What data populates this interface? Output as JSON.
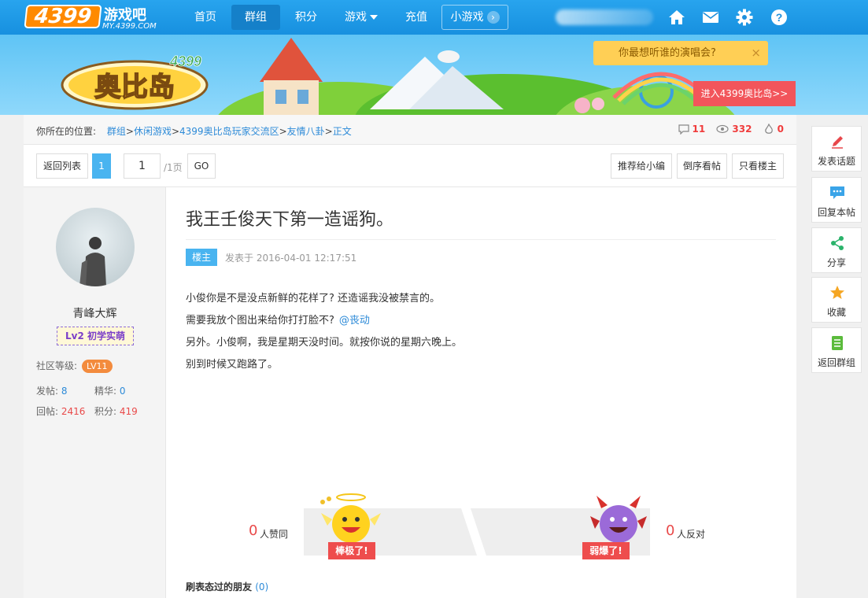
{
  "logo": {
    "number": "4399",
    "cn": "游戏吧",
    "en": "MY.4399.COM"
  },
  "nav": {
    "items": [
      {
        "label": "首页"
      },
      {
        "label": "群组"
      },
      {
        "label": "积分"
      },
      {
        "label": "游戏"
      },
      {
        "label": "充值"
      },
      {
        "label": "小游戏"
      }
    ]
  },
  "banner": {
    "logo_num": "4399",
    "logo_text": "奥比岛",
    "tip": "你最想听谁的演唱会?",
    "tip_close": "×",
    "enter_button": "进入4399奥比岛>>"
  },
  "breadcrumb": {
    "prefix": "你所在的位置:",
    "items": [
      "群组",
      "休闲游戏",
      "4399奥比岛玩家交流区",
      "友情八卦",
      "正文"
    ],
    "sep": ">"
  },
  "stats": {
    "comments": "11",
    "views": "332",
    "likes": "0"
  },
  "toolbar": {
    "back": "返回列表",
    "current_page": "1",
    "page_input": "1",
    "total": "/1页",
    "go": "GO",
    "recommend": "推荐给小编",
    "reverse": "倒序看帖",
    "owner_only": "只看楼主"
  },
  "user": {
    "name": "青峰大辉",
    "badge": "Lv2 初学实萌",
    "level_label": "社区等级:",
    "level": "LV11",
    "posts_label": "发帖:",
    "posts": "8",
    "essence_label": "精华:",
    "essence": "0",
    "replies_label": "回帖:",
    "replies": "2416",
    "points_label": "积分:",
    "points": "419"
  },
  "post": {
    "title": "我王壬俊天下第一造谣狗。",
    "floor": "楼主",
    "time": "发表于 2016-04-01 12:17:51",
    "lines": [
      "小俊你是不是没点新鲜的花样了? 还造谣我没被禁言的。",
      "需要我放个图出来给你打打脸不?",
      "另外。小俊啊，我是星期天没时间。就按你说的星期六晚上。",
      "别到时候又跑路了。"
    ],
    "mention": "@丧动"
  },
  "vote": {
    "up_count": "0",
    "up_label": "人赞同",
    "up_tag": "棒极了!",
    "down_tag": "弱爆了!",
    "down_count": "0",
    "down_label": "人反对"
  },
  "friends": {
    "label": "刷表态过的朋友",
    "count": "(0)"
  },
  "side": {
    "items": [
      {
        "label": "发表话题"
      },
      {
        "label": "回复本帖"
      },
      {
        "label": "分享"
      },
      {
        "label": "收藏"
      },
      {
        "label": "返回群组"
      }
    ]
  },
  "colors": {
    "nav_bg": "#1e9ae8",
    "accent_blue": "#49b4f0",
    "link": "#2e8bd8",
    "red": "#e94a4a",
    "tip_bg": "#ffcf55",
    "enter_btn": "#f2555b"
  }
}
